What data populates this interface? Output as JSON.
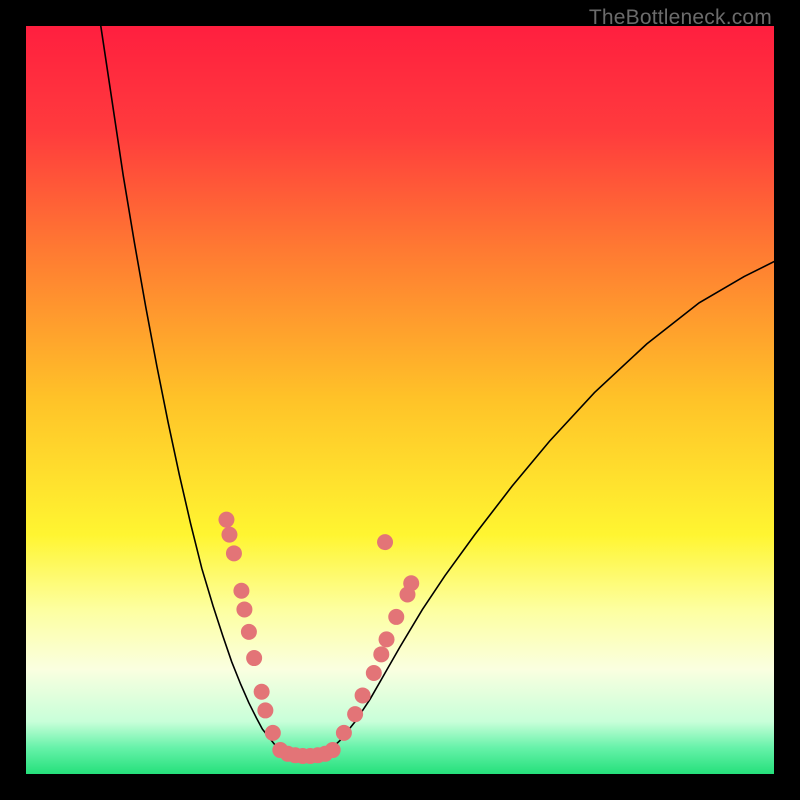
{
  "watermark": "TheBottleneck.com",
  "chart_data": {
    "type": "line",
    "title": "",
    "xlabel": "",
    "ylabel": "",
    "xlim": [
      0,
      100
    ],
    "ylim": [
      0,
      100
    ],
    "grid": false,
    "background_gradient": {
      "stops": [
        {
          "offset": 0.0,
          "color": "#ff1f3f"
        },
        {
          "offset": 0.14,
          "color": "#ff3b3d"
        },
        {
          "offset": 0.3,
          "color": "#ff7a32"
        },
        {
          "offset": 0.5,
          "color": "#ffc328"
        },
        {
          "offset": 0.68,
          "color": "#fff531"
        },
        {
          "offset": 0.78,
          "color": "#fdffa0"
        },
        {
          "offset": 0.86,
          "color": "#faffe0"
        },
        {
          "offset": 0.93,
          "color": "#c8ffd9"
        },
        {
          "offset": 0.965,
          "color": "#66f2a9"
        },
        {
          "offset": 1.0,
          "color": "#25e07b"
        }
      ]
    },
    "series": [
      {
        "name": "left-branch",
        "color": "#000000",
        "width": 1.6,
        "x": [
          10.0,
          11.5,
          13.0,
          14.5,
          16.0,
          17.5,
          19.0,
          20.5,
          22.0,
          23.5,
          25.0,
          26.3,
          27.5,
          28.7,
          29.8,
          30.8,
          31.6,
          32.4,
          33.2,
          34.0,
          35.0
        ],
        "y": [
          100.0,
          90.0,
          80.0,
          71.0,
          62.5,
          54.5,
          47.0,
          40.0,
          33.5,
          27.5,
          22.5,
          18.5,
          15.0,
          12.0,
          9.5,
          7.5,
          6.0,
          5.0,
          4.0,
          3.2,
          2.6
        ]
      },
      {
        "name": "valley-floor",
        "color": "#000000",
        "width": 1.6,
        "x": [
          35.0,
          36.0,
          37.0,
          38.0,
          39.0,
          40.0
        ],
        "y": [
          2.6,
          2.4,
          2.3,
          2.3,
          2.4,
          2.6
        ]
      },
      {
        "name": "right-branch",
        "color": "#000000",
        "width": 1.6,
        "x": [
          40.0,
          42.0,
          44.0,
          46.0,
          48.0,
          50.0,
          53.0,
          56.0,
          60.0,
          65.0,
          70.0,
          76.0,
          83.0,
          90.0,
          96.0,
          100.0
        ],
        "y": [
          2.6,
          4.5,
          7.0,
          10.0,
          13.5,
          17.0,
          22.0,
          26.5,
          32.0,
          38.5,
          44.5,
          51.0,
          57.5,
          63.0,
          66.5,
          68.5
        ]
      }
    ],
    "scatter": [
      {
        "name": "dots-left",
        "color": "#e37477",
        "radius": 8,
        "points": [
          {
            "x": 26.8,
            "y": 34.0
          },
          {
            "x": 27.2,
            "y": 32.0
          },
          {
            "x": 27.8,
            "y": 29.5
          },
          {
            "x": 28.8,
            "y": 24.5
          },
          {
            "x": 29.2,
            "y": 22.0
          },
          {
            "x": 29.8,
            "y": 19.0
          },
          {
            "x": 30.5,
            "y": 15.5
          },
          {
            "x": 31.5,
            "y": 11.0
          },
          {
            "x": 32.0,
            "y": 8.5
          },
          {
            "x": 33.0,
            "y": 5.5
          }
        ]
      },
      {
        "name": "dots-floor",
        "color": "#e37477",
        "radius": 8,
        "points": [
          {
            "x": 34.0,
            "y": 3.2
          },
          {
            "x": 35.0,
            "y": 2.7
          },
          {
            "x": 36.0,
            "y": 2.5
          },
          {
            "x": 37.0,
            "y": 2.4
          },
          {
            "x": 38.0,
            "y": 2.4
          },
          {
            "x": 39.0,
            "y": 2.5
          },
          {
            "x": 40.0,
            "y": 2.7
          },
          {
            "x": 41.0,
            "y": 3.2
          }
        ]
      },
      {
        "name": "dots-right",
        "color": "#e37477",
        "radius": 8,
        "points": [
          {
            "x": 42.5,
            "y": 5.5
          },
          {
            "x": 44.0,
            "y": 8.0
          },
          {
            "x": 45.0,
            "y": 10.5
          },
          {
            "x": 46.5,
            "y": 13.5
          },
          {
            "x": 47.5,
            "y": 16.0
          },
          {
            "x": 48.2,
            "y": 18.0
          },
          {
            "x": 49.5,
            "y": 21.0
          },
          {
            "x": 51.0,
            "y": 24.0
          },
          {
            "x": 51.5,
            "y": 25.5
          },
          {
            "x": 48.0,
            "y": 31.0
          }
        ]
      }
    ]
  }
}
